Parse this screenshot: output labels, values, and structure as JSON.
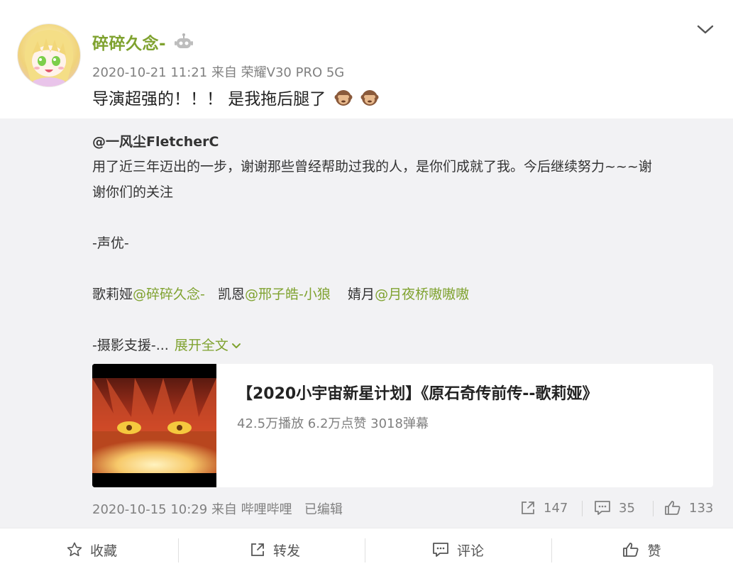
{
  "post": {
    "username": "碎碎久念-",
    "time": "2020-10-21 11:21",
    "source": "来自 荣耀V30 PRO 5G",
    "text": "导演超强的！！！ 是我拖后腿了"
  },
  "repost": {
    "author": "@一风尘FletcherC",
    "line1": "用了近三年迈出的一步，谢谢那些曾经帮助过我的人，是你们成就了我。今后继续努力~~~谢",
    "line2": "谢你们的关注",
    "line3": "-声优-",
    "cast": [
      {
        "role": "歌莉娅",
        "mention": "@碎碎久念-"
      },
      {
        "role": "凯恩",
        "mention": "@邢子皓-小狼"
      },
      {
        "role": "婧月",
        "mention": "@月夜桥嗷嗷嗷"
      }
    ],
    "line5": "-摄影支援-...",
    "expand_label": "展开全文",
    "video": {
      "title": "【2020小宇宙新星计划】《原石奇传前传--歌莉娅》",
      "stats": "42.5万播放 6.2万点赞 3018弹幕"
    },
    "footer": {
      "time": "2020-10-15 10:29",
      "source": "来自 哔哩哔哩",
      "edited": "已编辑",
      "reposts": "147",
      "comments": "35",
      "likes": "133"
    }
  },
  "actions": {
    "favorite": "收藏",
    "repost": "转发",
    "comment": "评论",
    "like": "赞"
  },
  "colors": {
    "accent": "#7fa22f",
    "meta": "#808080",
    "repost_bg": "#f2f2f4"
  },
  "icons": [
    "robot-badge-icon",
    "chevron-down-icon",
    "monkey-emoji-icon",
    "share-icon",
    "comment-icon",
    "thumb-up-icon",
    "star-icon"
  ]
}
